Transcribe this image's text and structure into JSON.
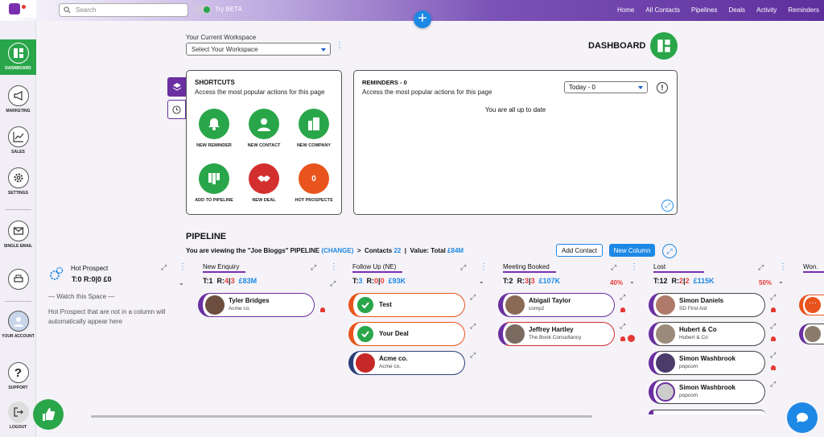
{
  "topbar": {
    "search_placeholder": "Search",
    "beta_label": "Try BETA",
    "nav": [
      "Home",
      "All Contacts",
      "Pipelines",
      "Deals",
      "Activity",
      "Reminders"
    ]
  },
  "sidebar": {
    "items": [
      {
        "label": "DASHBOARD",
        "icon": "dashboard-icon"
      },
      {
        "label": "MARKETING",
        "icon": "megaphone-icon"
      },
      {
        "label": "SALES",
        "icon": "chart-icon"
      },
      {
        "label": "SETTINGS",
        "icon": "gear-icon"
      },
      {
        "label": "SINGLE EMAIL",
        "icon": "envelope-icon"
      },
      {
        "label": "",
        "icon": "print-icon"
      },
      {
        "label": "YOUR ACCOUNT",
        "icon": "avatar-icon"
      },
      {
        "label": "SUPPORT",
        "icon": "question-icon"
      },
      {
        "label": "LOGOUT",
        "icon": "logout-icon"
      }
    ]
  },
  "workspace": {
    "label": "Your Current Workspace",
    "value": "Select Your Workspace"
  },
  "dashboard_title": "DASHBOARD",
  "shortcuts": {
    "title": "SHORTCUTS",
    "subtitle": "Access the most popular actions for this page",
    "items": [
      {
        "label": "NEW REMINDER",
        "color": "#2aa64a"
      },
      {
        "label": "NEW CONTACT",
        "color": "#2aa64a"
      },
      {
        "label": "NEW COMPANY",
        "color": "#2aa64a"
      },
      {
        "label": "ADD TO PIPELINE",
        "color": "#2aa64a"
      },
      {
        "label": "NEW DEAL",
        "color": "#d32f2f"
      },
      {
        "label": "HOT PROSPECTS",
        "color": "#e8541c",
        "count": "0"
      }
    ]
  },
  "reminders": {
    "title": "REMINDERS - 0",
    "subtitle": "Access the most popular actions for this page",
    "filter": "Today - 0",
    "empty": "You are all up to date"
  },
  "pipeline": {
    "title": "PIPELINE",
    "viewing": "You are viewing the \"Joe Bloggs\" PIPELINE",
    "change": "(CHANGE)",
    "contacts_label": "Contacts",
    "contacts": "22",
    "value_label": "Value: Total",
    "value": "£84M",
    "add_contact": "Add Contact",
    "new_column": "New Column",
    "hot": {
      "name": "Hot Prospect",
      "stats": "T:0  R:0|0  £0",
      "watch": "— Watch this Space —",
      "note": "Hot Prospect that are not in a column will automatically appear here"
    },
    "columns": [
      {
        "name": "New Enquiry",
        "t": "1",
        "r1": "4",
        "r2": "3",
        "val": "£83M",
        "pct": "",
        "cards": [
          {
            "name": "Tyler Bridges",
            "sub": "Acme co.",
            "border": "#6a2fa0"
          }
        ]
      },
      {
        "name": "Follow Up (NE)",
        "t": "3",
        "r1": "0",
        "r2": "0",
        "val": "£93K",
        "pct": "",
        "cards": [
          {
            "name": "Test",
            "sub": "",
            "border": "#e8541c"
          },
          {
            "name": "Your Deal",
            "sub": "",
            "border": "#e8541c"
          },
          {
            "name": "Acme co.",
            "sub": "Acme co.",
            "border": "#2a3f7a"
          }
        ]
      },
      {
        "name": "Meeting Booked",
        "t": "2",
        "r1": "3",
        "r2": "3",
        "val": "£107K",
        "pct": "40%",
        "cards": [
          {
            "name": "Abigail Taylor",
            "sub": "comp2",
            "border": "#6a2fa0"
          },
          {
            "name": "Jeffrey Hartley",
            "sub": "The Book Consultancy",
            "border": "#d32f2f"
          }
        ]
      },
      {
        "name": "Lost",
        "t": "12",
        "r1": "2",
        "r2": "2",
        "val": "£115K",
        "pct": "50%",
        "cards": [
          {
            "name": "Simon Daniels",
            "sub": "SD First Aid",
            "border": "#6a2fa0"
          },
          {
            "name": "Hubert & Co",
            "sub": "Hubert & Co",
            "border": "#6a2fa0"
          },
          {
            "name": "Simon Washbrook",
            "sub": "popcom",
            "border": "#6a2fa0"
          },
          {
            "name": "Simon Washbrook",
            "sub": "popcom",
            "border": "#6a2fa0"
          }
        ]
      },
      {
        "name": "Won.",
        "t": "",
        "r1": "",
        "r2": "",
        "val": "",
        "pct": "",
        "cards": []
      }
    ]
  }
}
